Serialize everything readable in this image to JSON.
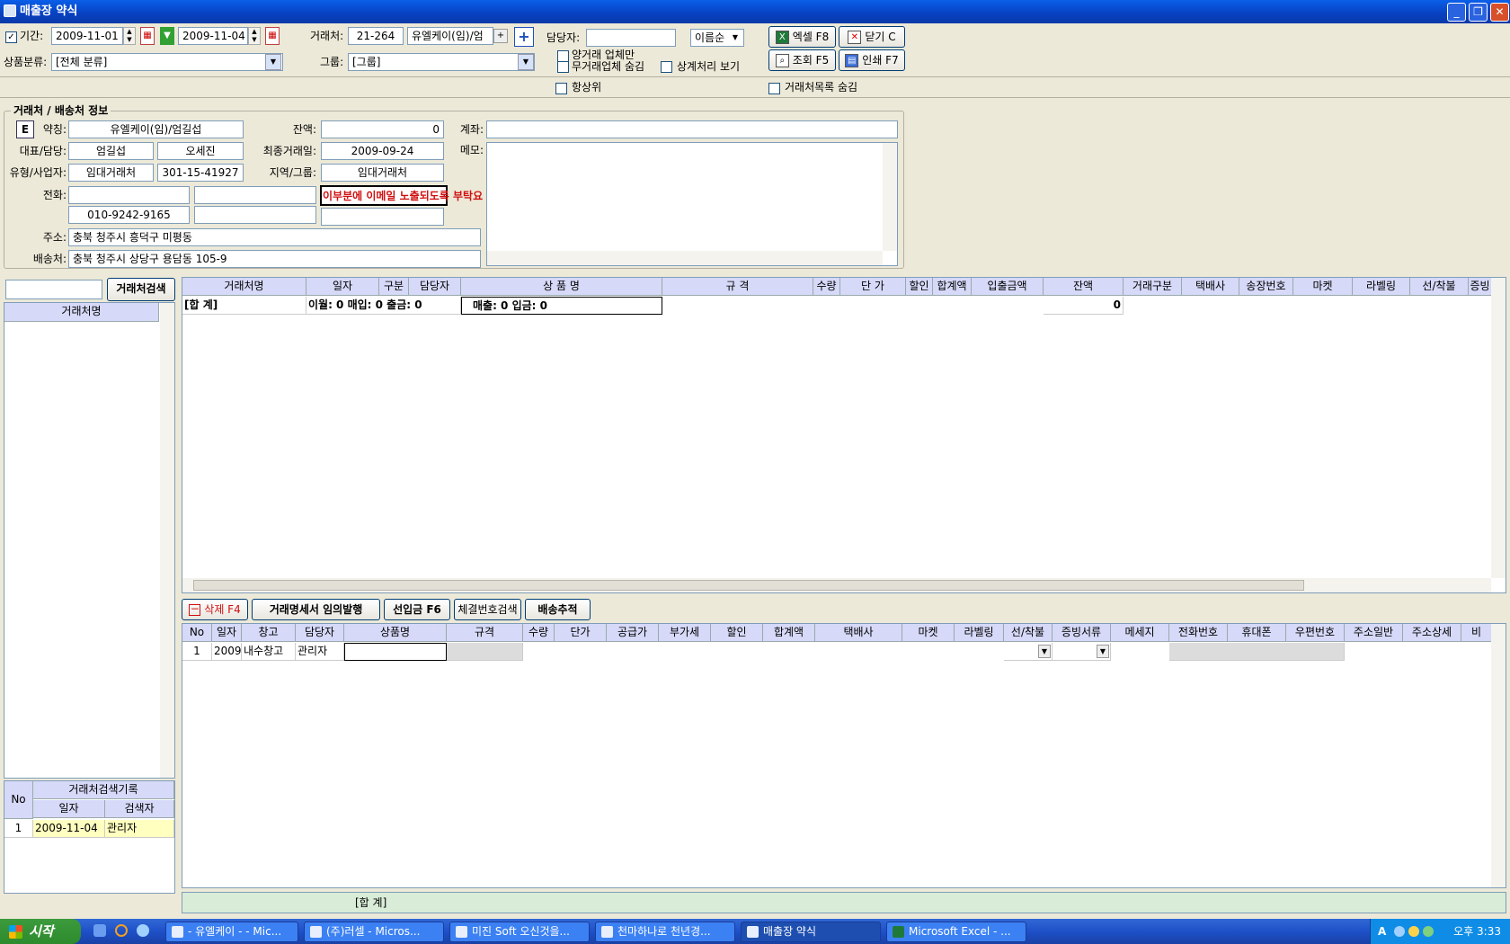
{
  "window": {
    "title": "매출장 약식",
    "controls": [
      "_",
      "❐",
      "✕"
    ]
  },
  "filter": {
    "period_label": "기간:",
    "date_from": "2009-11-01",
    "date_to": "2009-11-04",
    "client_label": "거래처:",
    "client_code": "21-264",
    "client_name": "유엘케이(임)/엄",
    "client_name_btn": "+",
    "add_btn": "+",
    "manager_label": "담당자:",
    "manager_value": "",
    "sort_value": "이름순",
    "category_label": "상품분류:",
    "category_value": "[전체 분류]",
    "group_label": "그룹:",
    "group_value": "[그룹]",
    "opt_positive": "양거래 업체만",
    "opt_hide_inactive": "무거래업체 숨김",
    "opt_offset": "상계처리 보기",
    "opt_top": "항상위",
    "opt_hide_list": "거래처목록 숨김"
  },
  "buttons": {
    "excel": "엑셀 F8",
    "close": "닫기 C",
    "query": "조회 F5",
    "print": "인쇄 F7"
  },
  "info": {
    "title": "거래처 / 배송처 정보",
    "e_btn": "E",
    "name_label": "약칭:",
    "name_value": "유엘케이(임)/엄길섭",
    "rep_label": "대표/담당:",
    "rep_value": "엄길섭",
    "rep_manager": "오세진",
    "type_label": "유형/사업자:",
    "type_value": "임대거래처",
    "biz_no": "301-15-41927",
    "phone_label": "전화:",
    "phone1": "",
    "phone2": "",
    "mobile": "010-9242-9165",
    "phone4": "",
    "address_label": "주소:",
    "address_value": "충북 청주시 흥덕구 미평동",
    "ship_label": "배송처:",
    "ship_value": "충북 청주시 상당구 용담동 105-9",
    "balance_label": "잔액:",
    "balance_value": "0",
    "last_label": "최종거래일:",
    "last_value": "2009-09-24",
    "region_label": "지역/그룹:",
    "region_value": "임대거래처",
    "email_note": "이부분에 이메일 노출되도록 부탁요",
    "account_label": "계좌:",
    "account_value": "",
    "memo_label": "메모:"
  },
  "search": {
    "input": "",
    "button": "거래처검색",
    "list_header": "거래처명"
  },
  "history": {
    "title": "거래처검색기록",
    "headers": [
      "No",
      "일자",
      "검색자"
    ],
    "rows": [
      [
        "1",
        "2009-11-04",
        "관리자"
      ]
    ]
  },
  "main_grid": {
    "headers": [
      "거래처명",
      "일자",
      "구분",
      "담당자",
      "상 품 명",
      "규 격",
      "수량",
      "단 가",
      "할인",
      "합계액",
      "입출금액",
      "잔액",
      "거래구분",
      "택배사",
      "송장번호",
      "마켓",
      "라벨링",
      "선/착불",
      "증빙"
    ],
    "sum_label": "[합 계]",
    "sum_items": "이월: 0   매입: 0   출금: 0",
    "sum_sales": "매출: 0   입금: 0",
    "sum_balance": "0"
  },
  "tabs": {
    "delete": "삭제 F4",
    "issue": "거래명세서 임의발행",
    "prepay": "선입금 F6",
    "settle": "체결번호검색",
    "track": "배송추적"
  },
  "detail_grid": {
    "headers": [
      "No",
      "일자",
      "창고",
      "담당자",
      "상품명",
      "규격",
      "수량",
      "단가",
      "공급가",
      "부가세",
      "할인",
      "합계액",
      "택배사",
      "마켓",
      "라벨링",
      "선/착불",
      "증빙서류",
      "메세지",
      "전화번호",
      "휴대폰",
      "우편번호",
      "주소일반",
      "주소상세",
      "비"
    ],
    "row": [
      "1",
      "2009-",
      "내수창고",
      "관리자"
    ],
    "sum_label": "[합 계]"
  },
  "taskbar": {
    "start": "시작",
    "items": [
      "- 유엘케이 - - Mic...",
      "(주)러셀 - Micros...",
      "미진 Soft 오신것을...",
      "천마하나로 천년경...",
      "매출장 약식",
      "Microsoft Excel - ..."
    ],
    "tray_ime": "A",
    "clock": "오후 3:33"
  }
}
